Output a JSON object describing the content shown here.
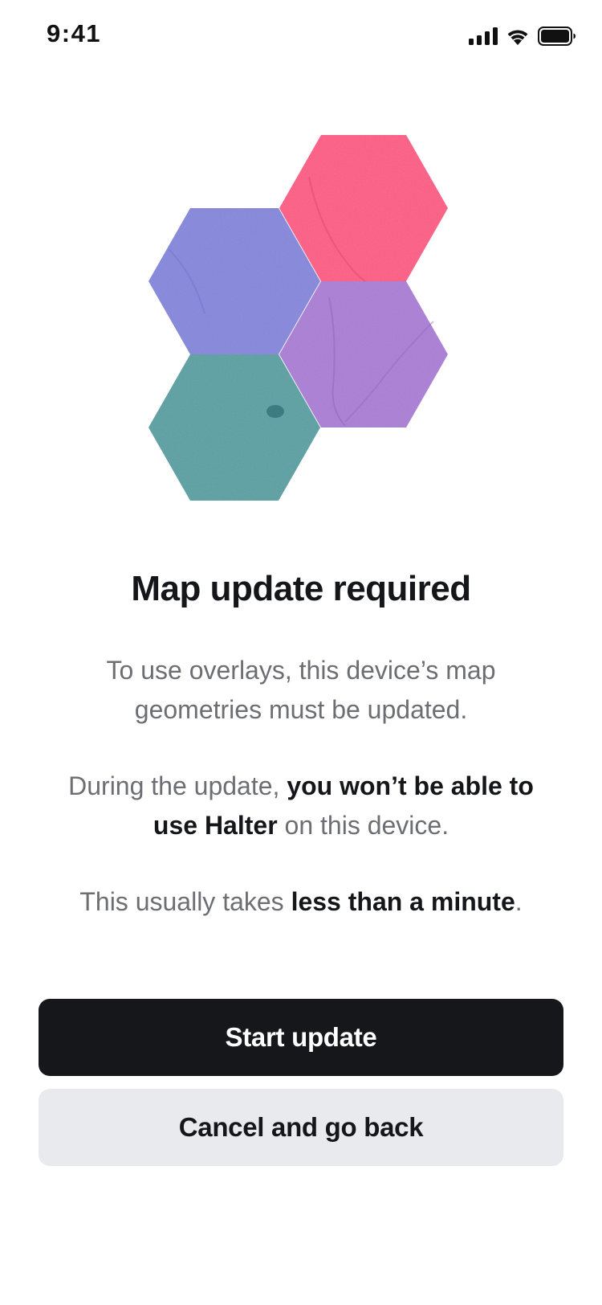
{
  "status_bar": {
    "time": "9:41"
  },
  "hero": {
    "hexagons": [
      {
        "name": "pink",
        "color": "#fd5b85"
      },
      {
        "name": "blue",
        "color": "#8587dc"
      },
      {
        "name": "purple",
        "color": "#ab7ed6"
      },
      {
        "name": "teal",
        "color": "#5aa0a3"
      }
    ]
  },
  "title": "Map update required",
  "paragraph1": {
    "text": "To use overlays, this device’s map geometries must be updated."
  },
  "paragraph2": {
    "before": "During the update, ",
    "bold": "you won’t be able to use Halter",
    "after": " on this device."
  },
  "paragraph3": {
    "before": "This usually takes ",
    "bold": "less than a minute",
    "after": "."
  },
  "buttons": {
    "primary": "Start update",
    "secondary": "Cancel and go back"
  }
}
